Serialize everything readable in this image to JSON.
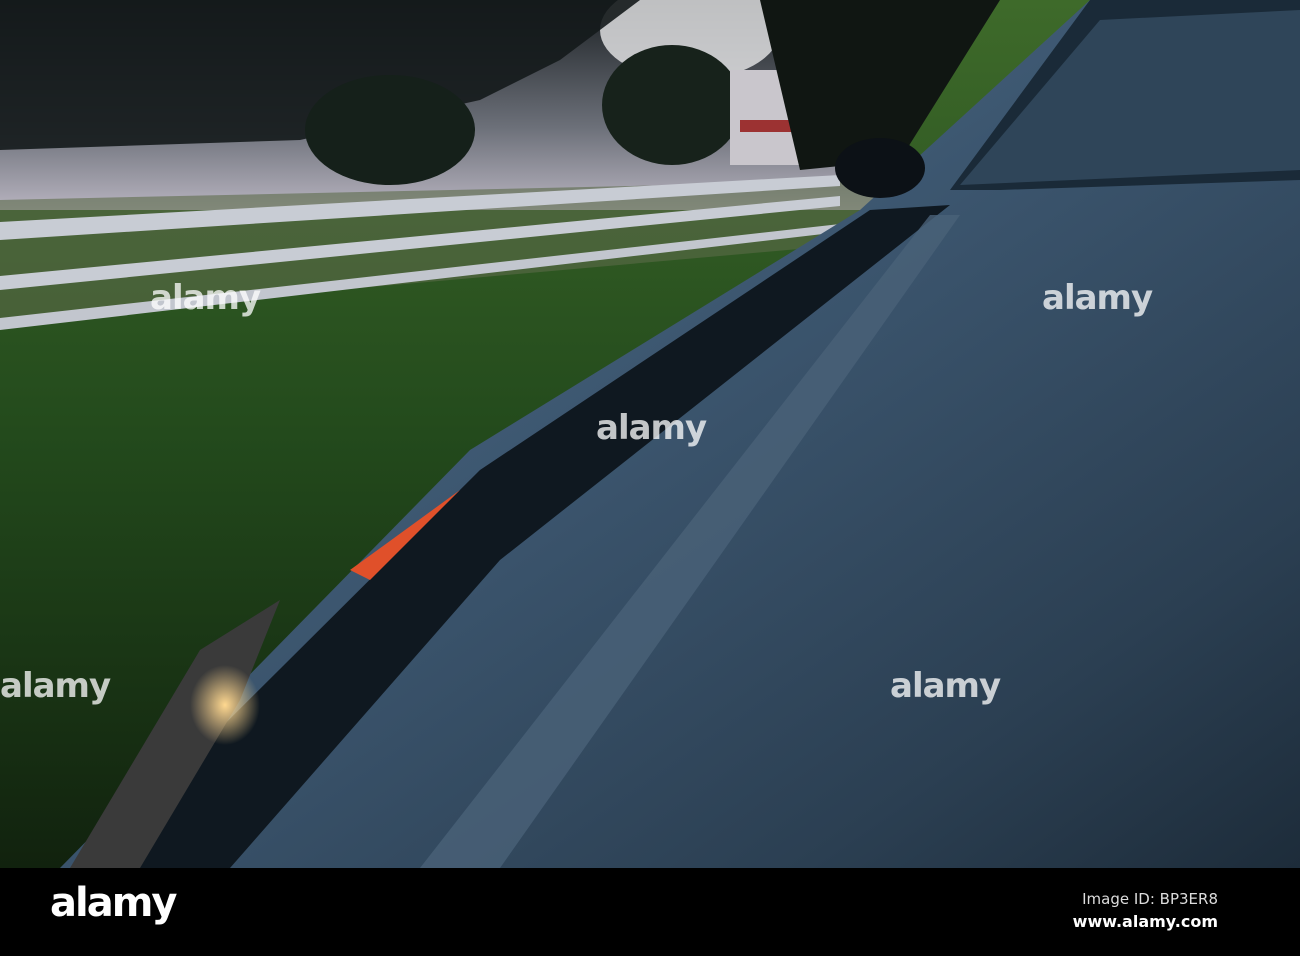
{
  "watermark": {
    "logo": "alamy",
    "text": "alamy"
  },
  "footer": {
    "logo": "alamy",
    "image_id": "Image ID: BP3ER8",
    "site": "www.alamy.com"
  }
}
